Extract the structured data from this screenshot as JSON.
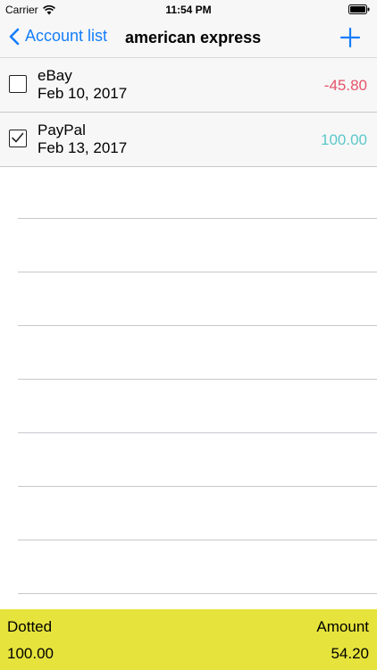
{
  "status_bar": {
    "carrier": "Carrier",
    "time": "11:54 PM"
  },
  "nav": {
    "back_label": "Account list",
    "title": "american express",
    "add_icon": "plus-icon",
    "accent_color": "#157efb"
  },
  "transactions": [
    {
      "name": "eBay",
      "date": "Feb 10, 2017",
      "amount": "-45.80",
      "checked": false,
      "amount_color": "#e5546a"
    },
    {
      "name": "PayPal",
      "date": "Feb 13, 2017",
      "amount": "100.00",
      "checked": true,
      "amount_color": "#5cc8c9"
    }
  ],
  "footer": {
    "dotted_label": "Dotted",
    "amount_label": "Amount",
    "dotted_value": "100.00",
    "amount_value": "54.20",
    "background_color": "#e6e33c"
  }
}
